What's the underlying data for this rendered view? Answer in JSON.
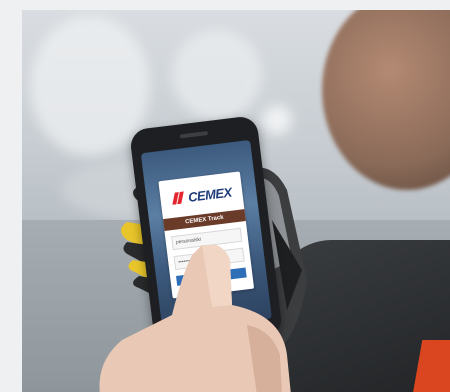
{
  "photo": {
    "brand": "CEMEX",
    "app_title": "CEMEX Track",
    "fields": [
      {
        "name": "username",
        "text": "personalski"
      },
      {
        "name": "password",
        "text": "••••••••••"
      }
    ],
    "colors": {
      "brand_red": "#e3262d",
      "brand_blue": "#1f3d7a",
      "title_bar": "#6b3b2a",
      "button_blue": "#2e6fb7",
      "glove_yellow": "#e8c52a"
    }
  }
}
